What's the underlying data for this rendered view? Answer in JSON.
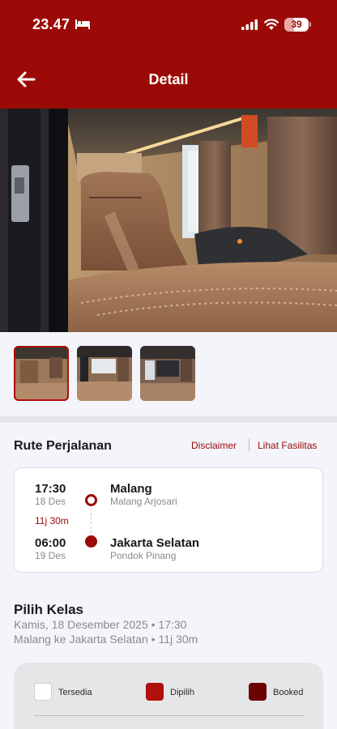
{
  "status_bar": {
    "time": "23.47",
    "battery": "39",
    "battery_level": 0.39,
    "icons": [
      "bed-icon",
      "signal-icon",
      "wifi-icon",
      "battery-icon"
    ]
  },
  "header": {
    "title": "Detail",
    "back_icon": "arrow-left-icon"
  },
  "gallery": {
    "selected_index": 0,
    "thumbnail_count": 3
  },
  "route": {
    "heading": "Rute Perjalanan",
    "disclaimer_link": "Disclaimer",
    "facilities_link": "Lihat Fasilitas",
    "departure": {
      "time": "17:30",
      "date": "18 Des",
      "city": "Malang",
      "stop": "Malang Arjosari"
    },
    "duration": "11j 30m",
    "arrival": {
      "time": "06:00",
      "date": "19 Des",
      "city": "Jakarta Selatan",
      "stop": "Pondok Pinang"
    }
  },
  "class_section": {
    "heading": "Pilih Kelas",
    "date_line": "Kamis, 18 Desember 2025 • 17:30",
    "route_line": "Malang ke Jakarta Selatan • 11j 30m"
  },
  "seat_legend": {
    "available": "Tersedia",
    "selected": "Dipilih",
    "booked": "Booked"
  },
  "colors": {
    "brand": "#9b0a06",
    "available": "#ffffff",
    "selected": "#b10f0a",
    "booked": "#6b0303"
  }
}
